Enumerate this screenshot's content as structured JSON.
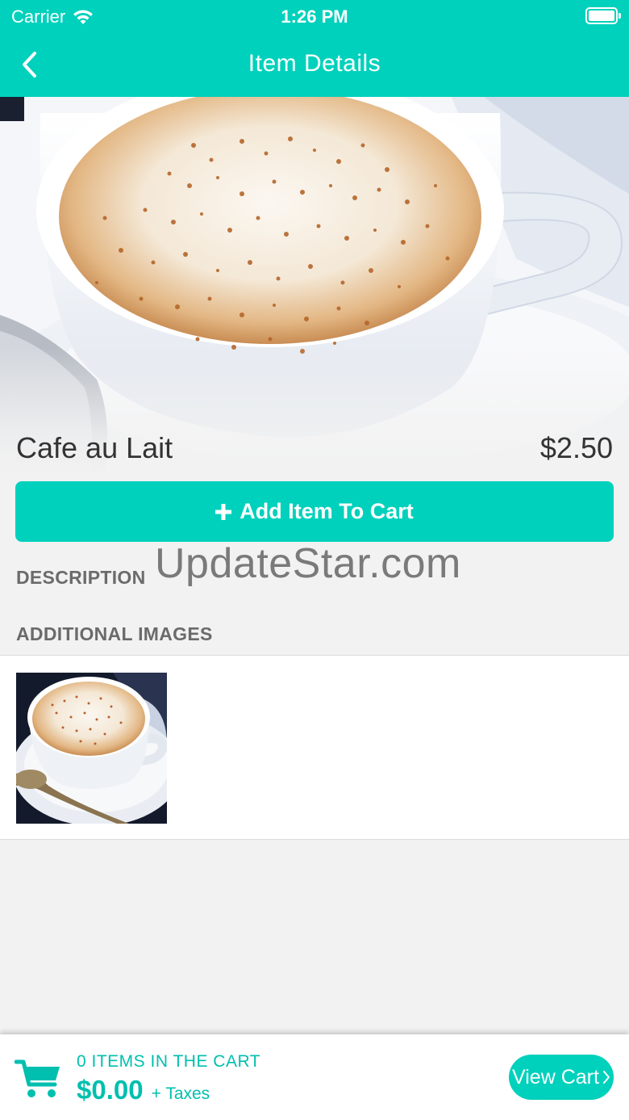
{
  "status_bar": {
    "carrier": "Carrier",
    "time": "1:26 PM"
  },
  "nav": {
    "title": "Item Details",
    "back_icon": "chevron-left-icon"
  },
  "item": {
    "name": "Cafe au Lait",
    "price": "$2.50",
    "image": "cafe-au-lait-photo"
  },
  "add_to_cart": {
    "label": "Add Item To Cart",
    "icon": "plus-icon"
  },
  "sections": {
    "description_label": "DESCRIPTION",
    "additional_images_label": "ADDITIONAL IMAGES"
  },
  "watermark": "UpdateStar.com",
  "cart": {
    "count_text": "0 ITEMS IN THE CART",
    "total": "$0.00",
    "taxes_text": "+ Taxes",
    "view_cart_label": "View Cart",
    "icon": "shopping-cart-icon"
  },
  "colors": {
    "accent": "#00d1bc",
    "accent_text": "#00bfae",
    "background": "#f2f2f2"
  }
}
